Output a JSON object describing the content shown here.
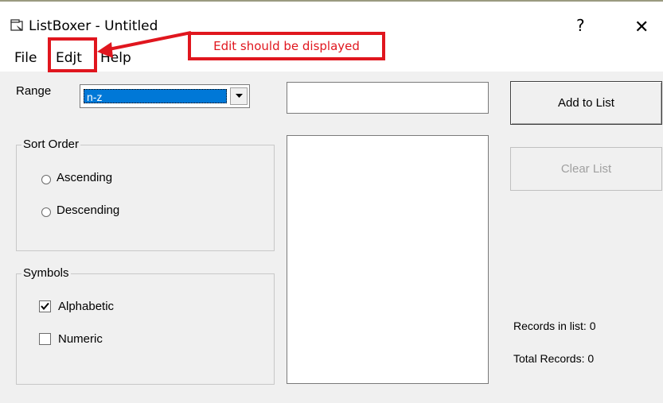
{
  "window": {
    "title": "ListBoxer - Untitled",
    "help_glyph": "?",
    "close_glyph": "✕"
  },
  "menu": {
    "file": "File",
    "edit": "Edjt",
    "help": "Help"
  },
  "annotation": {
    "text": "Edit should be displayed",
    "color": "#e0161e"
  },
  "range": {
    "label": "Range",
    "selected": "n-z"
  },
  "sort_order": {
    "title": "Sort Order",
    "options": [
      {
        "label": "Ascending",
        "checked": false
      },
      {
        "label": "Descending",
        "checked": false
      }
    ]
  },
  "symbols": {
    "title": "Symbols",
    "options": [
      {
        "label": "Alphabetic",
        "checked": true
      },
      {
        "label": "Numeric",
        "checked": false
      }
    ]
  },
  "input": {
    "value": ""
  },
  "buttons": {
    "add": "Add to List",
    "clear": "Clear List"
  },
  "status": {
    "records_in_list": "Records in list: 0",
    "total_records": "Total Records: 0"
  },
  "colors": {
    "selection": "#0078d7",
    "window_bg": "#f0f0f0"
  }
}
